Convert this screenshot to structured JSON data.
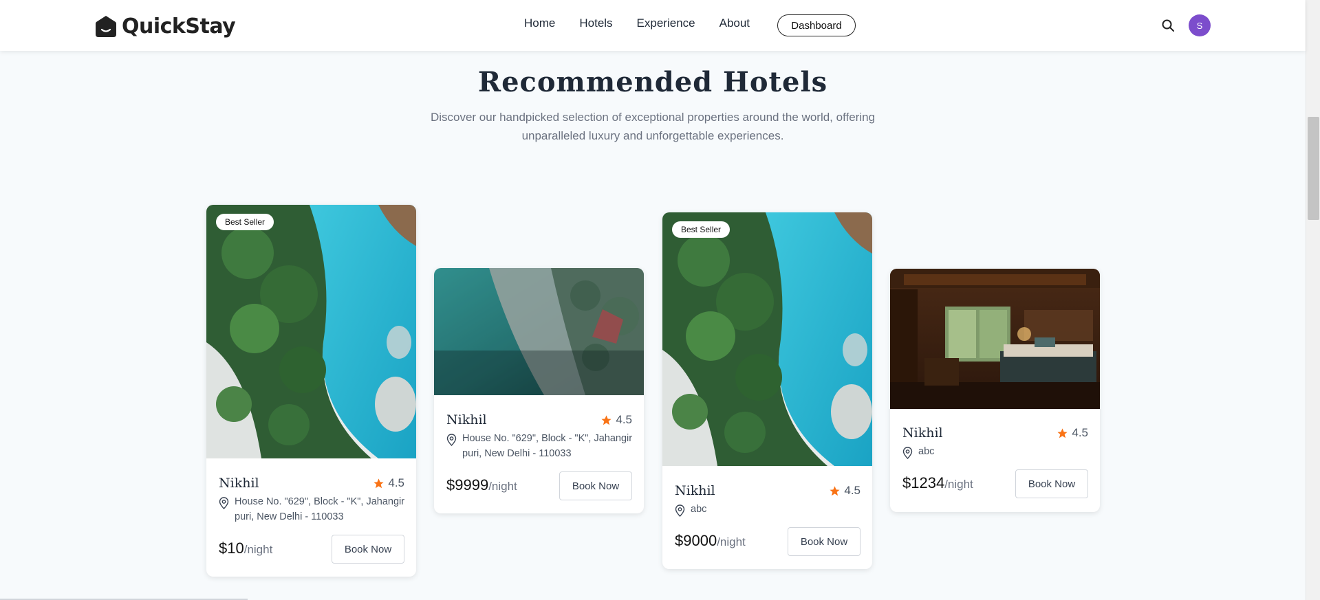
{
  "navbar": {
    "brand": "QuickStay",
    "links": [
      "Home",
      "Hotels",
      "Experience",
      "About"
    ],
    "dashboard_label": "Dashboard",
    "avatar_initial": "S"
  },
  "section": {
    "title": "Recommended Hotels",
    "subtitle": "Discover our handpicked selection of exceptional properties around the world, offering unparalleled luxury and unforgettable experiences."
  },
  "cards": [
    {
      "badge": "Best Seller",
      "name": "Nikhil",
      "rating": "4.5",
      "address": "House No. \"629\", Block - \"K\", Jahangir puri, New Delhi - 110033",
      "price": "$10",
      "price_unit": "/night",
      "button": "Book Now",
      "image": "resort-pool-aerial"
    },
    {
      "badge": "",
      "name": "Nikhil",
      "rating": "4.5",
      "address": "House No. \"629\", Block - \"K\", Jahangir puri, New Delhi - 110033",
      "price": "$9999",
      "price_unit": "/night",
      "button": "Book Now",
      "image": "beach-aerial"
    },
    {
      "badge": "Best Seller",
      "name": "Nikhil",
      "rating": "4.5",
      "address": "abc",
      "price": "$9000",
      "price_unit": "/night",
      "button": "Book Now",
      "image": "resort-pool-aerial"
    },
    {
      "badge": "",
      "name": "Nikhil",
      "rating": "4.5",
      "address": "abc",
      "price": "$1234",
      "price_unit": "/night",
      "button": "Book Now",
      "image": "hotel-bedroom"
    }
  ],
  "colors": {
    "accent_star": "#f97316",
    "avatar_bg": "#7c4dcc",
    "page_bg": "#f7fafc"
  }
}
